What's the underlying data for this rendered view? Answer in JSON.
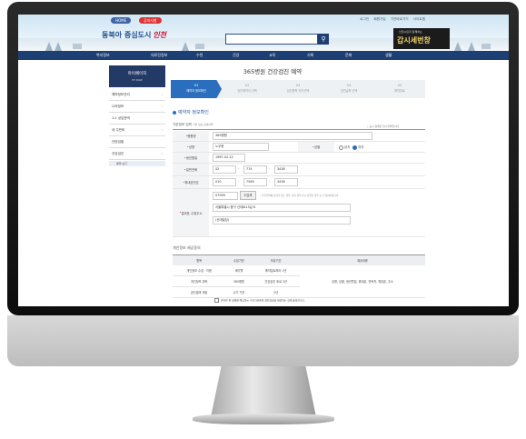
{
  "header": {
    "home_btn": "HOME",
    "notice_btn": "공지사항",
    "top_links": [
      "로그인",
      "회원가입",
      "기관바로가기",
      "사이트맵"
    ],
    "logo_text": "동북아 중심도시",
    "logo_script": "인천",
    "search_icon": "search-icon",
    "banner_small": "인천시민과 함께하는",
    "banner_big": "갑시세번창"
  },
  "nav": [
    "복지정보",
    "의료진정보",
    "수련",
    "건강",
    "교육",
    "기록",
    "문화",
    "생활"
  ],
  "sidebar": {
    "title": "마이페이지",
    "subtitle": "MY PAGE",
    "items": [
      {
        "label": "예약정보관리",
        "arrow": "›"
      },
      {
        "label": "나의정보",
        "arrow": "›"
      },
      {
        "label": "1:1 상담문의",
        "arrow": ""
      },
      {
        "label": "내 주민비",
        "arrow": "›"
      },
      {
        "label": "관련검출",
        "arrow": ""
      },
      {
        "label": "건강검진",
        "arrow": "›"
      }
    ],
    "sub_item": "예약 보기"
  },
  "main": {
    "title": "365병원 건강검진 예약",
    "steps": [
      {
        "num": "01",
        "label": "예약자 정보확인",
        "active": true
      },
      {
        "num": "02",
        "label": "검진예약자 선택",
        "active": false
      },
      {
        "num": "03",
        "label": "검진항목 추가선택",
        "active": false
      },
      {
        "num": "04",
        "label": "검진날짜 선택",
        "active": false
      },
      {
        "num": "05",
        "label": "예약완료",
        "active": false
      }
    ],
    "section_title": "예약자 정보확인",
    "subsection": "기본정보 입력",
    "subsection_note": "기본 정보 상세내역",
    "required_note": "• 표시 항목은 필수입력입니다.",
    "fields": {
      "hospital_label": "병원명",
      "hospital_value": "365병원",
      "name_label": "성명",
      "name_value": "노우현",
      "gender_label": "성별",
      "gender_options": [
        "남자",
        "여자"
      ],
      "gender_selected": "여자",
      "birth_label": "생년월일",
      "birth_value": "1987-02-22",
      "phone_label": "일반전화",
      "phone": [
        "02",
        "774",
        "3438"
      ],
      "mobile_label": "휴대폰번호",
      "mobile": [
        "010",
        "7569",
        "3438"
      ],
      "address_label": "결과표 수령주소",
      "zip": "07999",
      "zip_btn": "검색",
      "zip_note": "• 주소입력에 동의가 있는 경우, 동의 여부 수시 진행할 경우 등 수 있어야합니다.",
      "addr1": "서울특별시 중구 신대로13길 8",
      "addr2": "(신대빌딩)"
    },
    "consent_title": "개인정보 제공동의",
    "consent_headers": [
      "항목",
      "수집기관",
      "보유기간",
      "제공내용"
    ],
    "consent_rows": [
      [
        "개인정보 수집 · 이용",
        "세이웰",
        "예약일로부터 1년",
        ""
      ],
      [
        "개인정보 위탁",
        "365병원",
        "건강검진 후로 2년",
        "성명, 성별, 생년월일, 휴대폰, 연락처, 휴대폰, 주소"
      ],
      [
        "공진결과 제공",
        "수가 기관",
        "2년",
        ""
      ]
    ],
    "agree_text": "본인은 위 항목에 해당하는 수탁기관에게 개인정보를 제공하는 것에 동의합니다."
  },
  "colors": {
    "primary": "#2a6ebd",
    "nav": "#1e3f73",
    "sidebar": "#243a66",
    "accent": "#c8102e"
  }
}
